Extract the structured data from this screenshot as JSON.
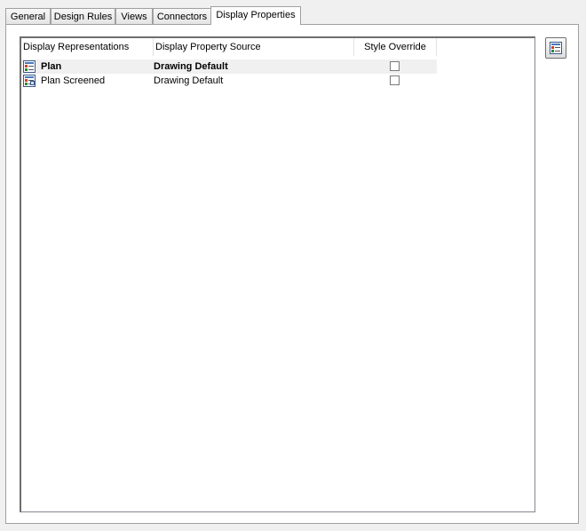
{
  "tabs": [
    {
      "label": "General"
    },
    {
      "label": "Design Rules"
    },
    {
      "label": "Views"
    },
    {
      "label": "Connectors"
    },
    {
      "label": "Display Properties"
    }
  ],
  "active_tab": "Display Properties",
  "columns": {
    "representation": "Display Representations",
    "source": "Display Property Source",
    "override": "Style Override"
  },
  "rows": [
    {
      "representation": "Plan",
      "source": "Drawing Default",
      "override": false,
      "bold": true,
      "selected": true,
      "icon": "display-representation-icon"
    },
    {
      "representation": "Plan Screened",
      "source": "Drawing Default",
      "override": false,
      "bold": false,
      "selected": false,
      "icon": "display-representation-screened-icon"
    }
  ],
  "side_button_icon": "edit-display-properties-icon",
  "colors": {
    "tab_border": "#a0a0a0",
    "selected_row": "#f0f0f0",
    "icon_blue": "#4a78b8"
  }
}
